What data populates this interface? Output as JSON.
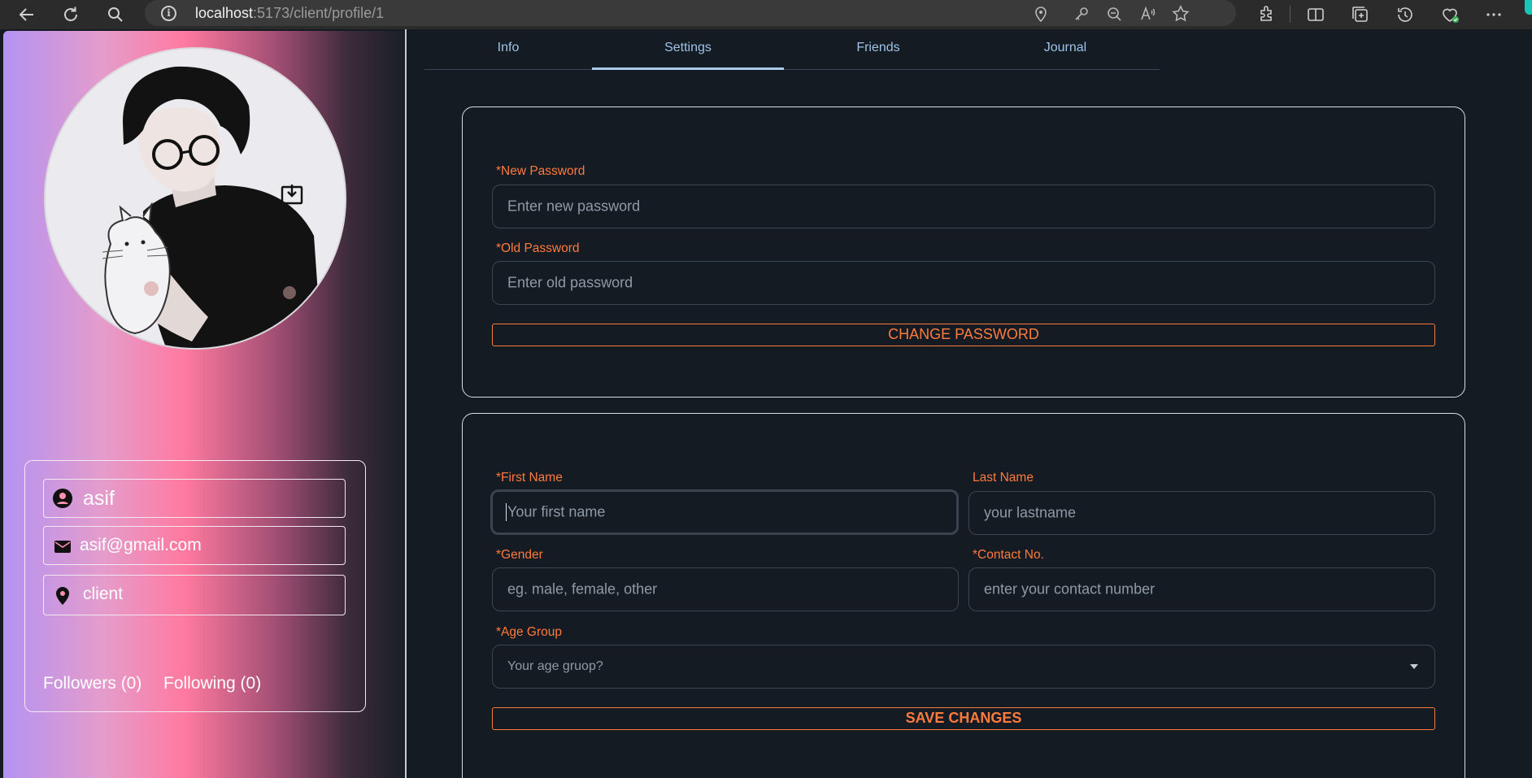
{
  "browser": {
    "url_host": "localhost",
    "url_path": ":5173/client/profile/1"
  },
  "profile": {
    "username": "asif",
    "email": "asif@gmail.com",
    "role": "client",
    "followers_label": "Followers (0)",
    "following_label": "Following (0)"
  },
  "tabs": [
    {
      "label": "Info"
    },
    {
      "label": "Settings",
      "active": true
    },
    {
      "label": "Friends"
    },
    {
      "label": "Journal"
    }
  ],
  "password_form": {
    "new_password_label": "*New Password",
    "new_password_placeholder": "Enter new password",
    "old_password_label": "*Old Password",
    "old_password_placeholder": "Enter old password",
    "submit_label": "CHANGE PASSWORD"
  },
  "profile_form": {
    "first_name_label": "*First Name",
    "first_name_placeholder": "Your first name",
    "last_name_label": "Last Name",
    "last_name_placeholder": "your lastname",
    "gender_label": "*Gender",
    "gender_placeholder": "eg. male, female, other",
    "contact_label": "*Contact No.",
    "contact_placeholder": "enter your contact number",
    "age_group_label": "*Age Group",
    "age_group_placeholder": "Your age gruop?",
    "submit_label": "SAVE CHANGES"
  },
  "colors": {
    "accent": "#ff7a3d",
    "page_bg": "#141b22",
    "tab_text": "#9fc3e8"
  }
}
